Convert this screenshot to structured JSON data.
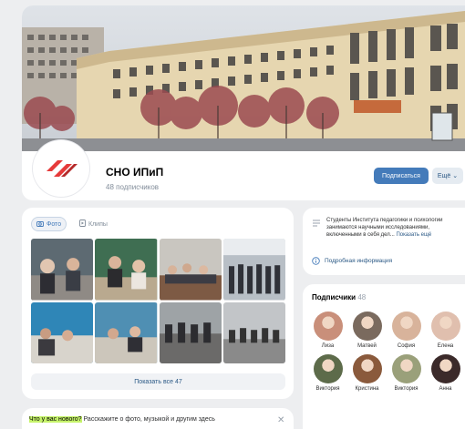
{
  "group": {
    "name": "СНО ИПиП",
    "subscribers": "48 подписчиков",
    "subscribe_label": "Подписаться",
    "more_label": "Ещё"
  },
  "media": {
    "tabs": [
      {
        "label": "Фото",
        "icon": "camera-icon",
        "active": true
      },
      {
        "label": "Клипы",
        "icon": "clips-icon",
        "active": false
      }
    ],
    "show_all_label": "Показать все 47"
  },
  "info": {
    "description": "Студенты Института педагогики и психологии занимаются научными исследованиями, включенными в себя дел...",
    "show_more": "Показать ещё",
    "details_label": "Подробная информация"
  },
  "subscribers": {
    "title": "Подписчики",
    "count": "48",
    "people": [
      {
        "name": "Лиза",
        "color": "#c98f7a"
      },
      {
        "name": "Матвей",
        "color": "#7a6a5e"
      },
      {
        "name": "София",
        "color": "#d8b39b"
      },
      {
        "name": "Елена",
        "color": "#e0bfae"
      },
      {
        "name": "Виктория",
        "color": "#5d6b4a"
      },
      {
        "name": "Кристина",
        "color": "#8a5a3c"
      },
      {
        "name": "Виктория",
        "color": "#9aa07a"
      },
      {
        "name": "Анна",
        "color": "#3b2a2a"
      }
    ]
  },
  "newpost": {
    "highlight": "Что у вас нового?",
    "text": "Расскажите о фото, музыкой и другим здесь"
  },
  "colors": {
    "accent": "#447bba",
    "link": "#2a5885",
    "background": "#edeef0",
    "logo_red": "#e63a3a"
  }
}
